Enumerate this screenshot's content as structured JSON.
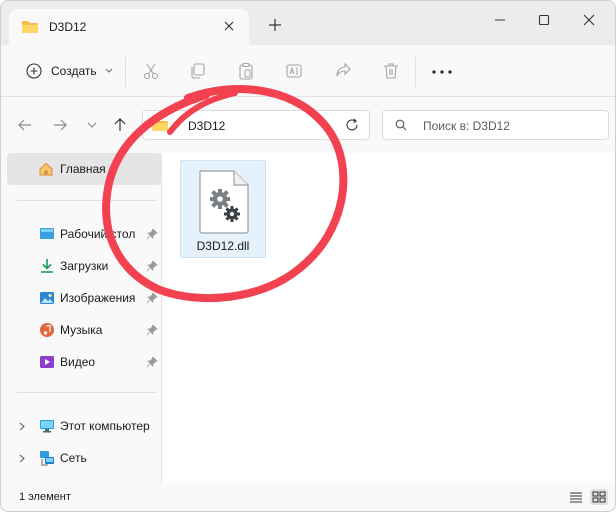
{
  "colors": {
    "accent": "#0067c0",
    "folder": "#f5c04a",
    "annotation": "#f2414f"
  },
  "tab": {
    "title": "D3D12",
    "icon": "folder-icon"
  },
  "toolbar": {
    "create_label": "Создать",
    "icons": [
      "cut-icon",
      "copy-icon",
      "paste-icon",
      "rename-icon",
      "share-icon",
      "delete-icon",
      "more-icon"
    ]
  },
  "address": {
    "crumb": "D3D12"
  },
  "search": {
    "placeholder": "Поиск в: D3D12"
  },
  "sidebar": {
    "home": "Главная",
    "quick_access": [
      {
        "label": "Рабочий стол",
        "icon": "desktop-icon"
      },
      {
        "label": "Загрузки",
        "icon": "downloads-icon"
      },
      {
        "label": "Изображения",
        "icon": "pictures-icon"
      },
      {
        "label": "Музыка",
        "icon": "music-icon"
      },
      {
        "label": "Видео",
        "icon": "video-icon"
      }
    ],
    "this_pc": "Этот компьютер",
    "network": "Сеть"
  },
  "files": [
    {
      "name": "D3D12.dll",
      "icon": "dll-file-icon"
    }
  ],
  "status": {
    "count": "1 элемент"
  }
}
